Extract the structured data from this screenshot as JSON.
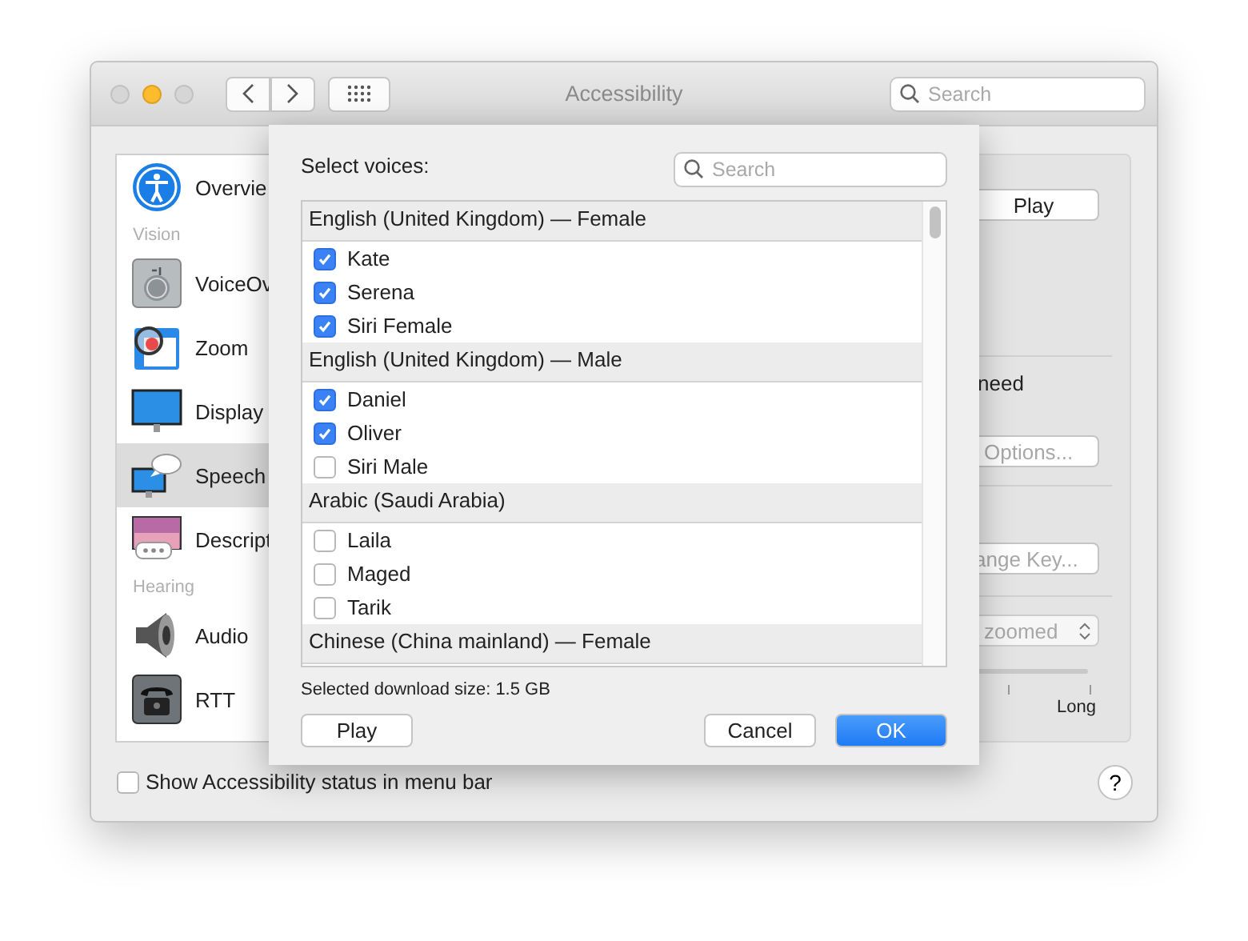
{
  "window": {
    "title": "Accessibility",
    "search_placeholder": "Search"
  },
  "sidebar": {
    "items": [
      {
        "kind": "item",
        "label": "Overvie",
        "selected": false
      },
      {
        "kind": "section",
        "label": "Vision"
      },
      {
        "kind": "item",
        "label": "VoiceOv",
        "selected": false
      },
      {
        "kind": "item",
        "label": "Zoom",
        "selected": false
      },
      {
        "kind": "item",
        "label": "Display",
        "selected": false
      },
      {
        "kind": "item",
        "label": "Speech",
        "selected": true
      },
      {
        "kind": "item",
        "label": "Descript",
        "selected": false
      },
      {
        "kind": "section",
        "label": "Hearing"
      },
      {
        "kind": "item",
        "label": "Audio",
        "selected": false
      },
      {
        "kind": "item",
        "label": "RTT",
        "selected": false
      }
    ]
  },
  "panel": {
    "play_button": "Play",
    "checkbox_text": "need",
    "options_button": {
      "label": "Options...",
      "disabled": true
    },
    "key_button": {
      "label": "ange Key...",
      "disabled": true
    },
    "select_value": "zoomed",
    "slider_label": "Long"
  },
  "sheet": {
    "title": "Select voices:",
    "search_placeholder": "Search",
    "groups": [
      {
        "header": "English (United Kingdom) — Female",
        "voices": [
          {
            "name": "Kate",
            "checked": true
          },
          {
            "name": "Serena",
            "checked": true
          },
          {
            "name": "Siri Female",
            "checked": true
          }
        ]
      },
      {
        "header": "English (United Kingdom) — Male",
        "voices": [
          {
            "name": "Daniel",
            "checked": true
          },
          {
            "name": "Oliver",
            "checked": true
          },
          {
            "name": "Siri Male",
            "checked": false
          }
        ]
      },
      {
        "header": "Arabic (Saudi Arabia)",
        "voices": [
          {
            "name": "Laila",
            "checked": false
          },
          {
            "name": "Maged",
            "checked": false
          },
          {
            "name": "Tarik",
            "checked": false
          }
        ]
      },
      {
        "header": "Chinese (China mainland) — Female"
      }
    ],
    "download_size": "Selected download size: 1.5 GB",
    "buttons": {
      "play": "Play",
      "cancel": "Cancel",
      "ok": "OK"
    }
  },
  "footer": {
    "status_checkbox": {
      "label": "Show Accessibility status in menu bar",
      "checked": false
    },
    "help": "?"
  }
}
